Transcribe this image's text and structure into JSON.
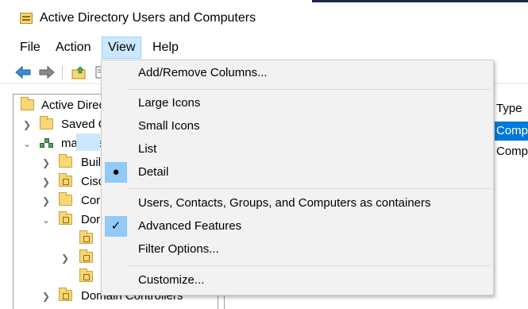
{
  "window": {
    "title": "Active Directory Users and Computers"
  },
  "menubar": {
    "items": [
      "File",
      "Action",
      "View",
      "Help"
    ]
  },
  "view_menu": {
    "add_remove_columns": "Add/Remove Columns...",
    "large_icons": "Large Icons",
    "small_icons": "Small Icons",
    "list": "List",
    "detail": "Detail",
    "containers": "Users, Contacts, Groups, and Computers as containers",
    "advanced_features": "Advanced Features",
    "filter_options": "Filter Options...",
    "customize": "Customize..."
  },
  "tree": {
    "root": "Active Direc",
    "saved": "Saved Q",
    "domain": "massive",
    "builtin": "Buil",
    "cisco": "Cisc",
    "computers": "Cor",
    "domain_ou": "Dor",
    "domain_controllers": "Domain Controllers"
  },
  "detail_pane": {
    "column_type": "Type",
    "rows": [
      "Comp",
      "Comp"
    ]
  },
  "colors": {
    "selection": "#0078d7",
    "menu_highlight": "#cce8ff",
    "check_bg": "#91c9f7"
  }
}
